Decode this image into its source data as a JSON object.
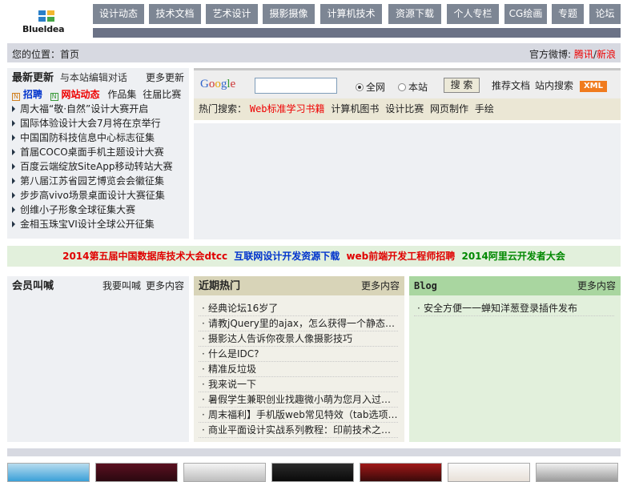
{
  "logo": {
    "text": "Blueldea"
  },
  "nav": [
    "设计动态",
    "技术文档",
    "艺术设计",
    "摄影摄像",
    "计算机技术",
    "资源下载",
    "个人专栏",
    "CG绘画",
    "专题",
    "论坛"
  ],
  "breadcrumb": {
    "label": "您的位置：",
    "home": "首页",
    "weibo_label": "官方微博:",
    "tencent": "腾讯",
    "slash": "/",
    "sina": "新浪"
  },
  "latest": {
    "title": "最新更新",
    "chat": "与本站编辑对话",
    "more": "更多更新",
    "tags": [
      {
        "icon": "N",
        "label": "招聘",
        "red": true
      },
      {
        "icon": "N",
        "label": "网站动态",
        "red": true
      },
      {
        "icon": "",
        "label": "作品集",
        "red": false
      },
      {
        "icon": "",
        "label": "往届比赛",
        "red": false
      }
    ],
    "items": [
      "周大福“敬·自然”设计大赛开启",
      "国际体验设计大会7月将在京举行",
      "中国国防科技信息中心标志征集",
      "首届COCO桌面手机主题设计大赛",
      "百度云端绽放SiteApp移动转站大赛",
      "第八届江苏省园艺博览会会徽征集",
      "步步高vivo场景桌面设计大赛征集",
      "创维小子形象全球征集大赛",
      "金相玉珠宝VI设计全球公开征集"
    ]
  },
  "search": {
    "google": "Google",
    "value": "",
    "opt_all": "全网",
    "opt_site": "本站",
    "button": "搜 索",
    "recommend": "推荐文档",
    "site_search": "站内搜索",
    "xml": "XML"
  },
  "hot_search": {
    "label": "热门搜索：",
    "items": [
      {
        "label": "Web标准学习书籍",
        "red": true
      },
      {
        "label": "计算机图书",
        "red": false
      },
      {
        "label": "设计比赛",
        "red": false
      },
      {
        "label": "网页制作",
        "red": false
      },
      {
        "label": "手绘",
        "red": false
      }
    ]
  },
  "ad_links": [
    {
      "label": "2014第五届中国数据库技术大会dtcc",
      "color": "#e00000"
    },
    {
      "label": "互联网设计开发资源下载",
      "color": "#0033cc"
    },
    {
      "label": "web前端开发工程师招聘",
      "color": "#e00000"
    },
    {
      "label": "2014阿里云开发者大会",
      "color": "#008800"
    }
  ],
  "members": {
    "title": "会员叫喊",
    "shout": "我要叫喊",
    "more": "更多内容"
  },
  "hot": {
    "title": "近期热门",
    "more": "更多内容",
    "items": [
      "经典论坛16岁了",
      "请教jQuery里的ajax，怎么获得一个静态…",
      "摄影达人告诉你夜景人像摄影技巧",
      "什么是IDC?",
      "精准反垃圾",
      "我来说一下",
      "暑假学生兼职创业找趣微小萌为您月入过…",
      "周末福利】手机版web常见特效（tab选项…",
      "商业平面设计实战系列教程：印前技术之…"
    ]
  },
  "blog": {
    "title": "Blog",
    "more": "更多内容",
    "items": [
      "安全方便一一蝉知洋葱登录插件发布"
    ]
  },
  "colors": {
    "nav_bg": "#7d8694",
    "hot_bg": "#d8d4b8",
    "blog_bg": "#a9d6a0",
    "ad_bg": "#e2f0dc"
  }
}
